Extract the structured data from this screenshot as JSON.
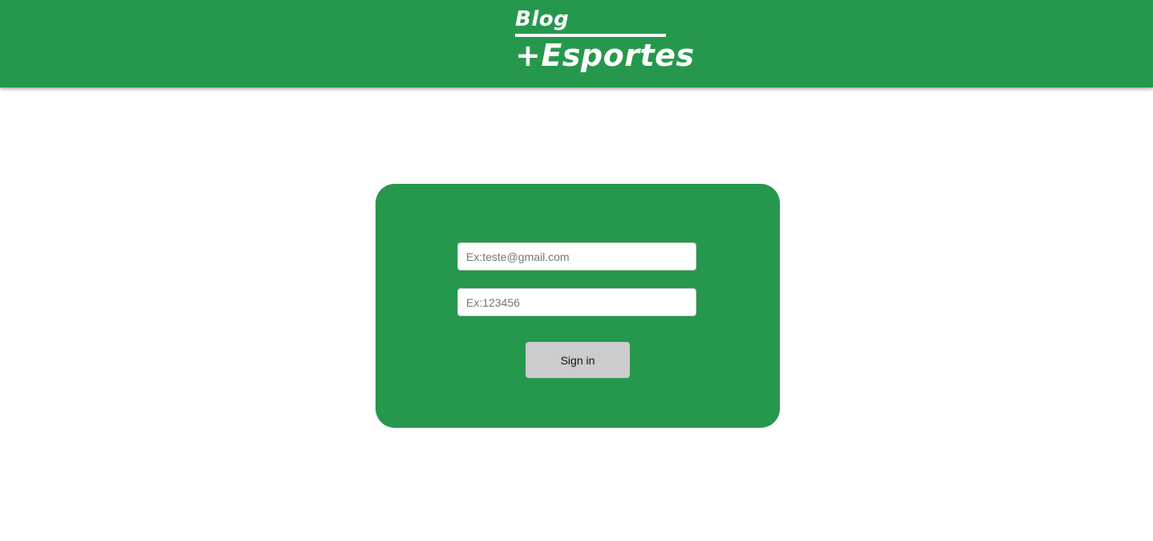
{
  "header": {
    "logo_top": "Blog",
    "logo_bottom": "+Esportes",
    "background_color": "#26984d"
  },
  "login": {
    "email_placeholder": "Ex:teste@gmail.com",
    "email_value": "",
    "password_placeholder": "Ex:123456",
    "password_value": "",
    "signin_label": "Sign in",
    "card_color": "#26984d",
    "button_color": "#cccccc"
  }
}
